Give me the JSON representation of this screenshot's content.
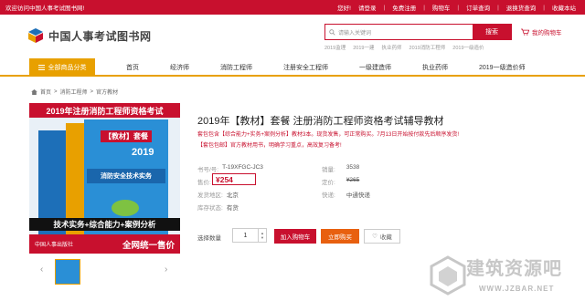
{
  "topbar": {
    "welcome": "欢迎访问中国人事考试图书网!",
    "links": [
      "您好!",
      "请登录",
      "免费注册",
      "购物车",
      "订单查询",
      "退换货查询",
      "收藏本站"
    ]
  },
  "header": {
    "logo_text": "中国人事考试图书网",
    "search_placeholder": "请输入关键词",
    "search_button": "搜索",
    "hot_words": [
      "2019监理",
      "2019一建",
      "执业药师",
      "2019消防工程师",
      "2019一级造价"
    ],
    "cart_label": "我的购物车"
  },
  "nav": {
    "all_categories": "全部商品分类",
    "items": [
      "首页",
      "经济师",
      "消防工程师",
      "注册安全工程师",
      "一级建造师",
      "执业药师",
      "2019一级造价师"
    ]
  },
  "breadcrumb": [
    "首页",
    "消防工程师",
    "官方教材"
  ],
  "product_image": {
    "top_title": "2019年注册消防工程师资格考试",
    "year": "2019",
    "tag": "【教材】套餐",
    "book_name": "消防安全技术实务",
    "bottom_line": "技术实务+综合能力+案例分析",
    "publisher": "中国人事出版社",
    "uniform_price": "全网统一售价"
  },
  "product": {
    "title": "2019年【教材】套餐 注册消防工程师资格考试辅导教材",
    "promo1": "套包包含【综合能力+实务+案例分析】教材3本。现货发售，可正常购买。7月13日开始按付款先后顺序发货!",
    "promo2": "【套包包邮】官方教材用书，明确学习重点，高效复习备考!",
    "fields": {
      "sku_label": "书号/号:",
      "sku": "T-19XFGC-JC3",
      "sales_label": "销量:",
      "sales": "3538",
      "price_label": "售价:",
      "price": "¥254",
      "list_price_label": "定价:",
      "list_price": "¥265",
      "shipfrom_label": "发货地区:",
      "shipfrom": "北京",
      "express_label": "快递:",
      "express": "中通快递",
      "stock_label": "库存状态:",
      "stock": "有货"
    },
    "qty_label": "选择数量",
    "qty": "1",
    "add_to_cart": "加入购物车",
    "buy_now": "立即购买",
    "favorite": "收藏"
  },
  "watermark": {
    "cn": "建筑资源吧",
    "en": "WWW.JZBAR.NET"
  },
  "colors": {
    "brand_red": "#c8102e",
    "accent_orange": "#e8a000"
  }
}
